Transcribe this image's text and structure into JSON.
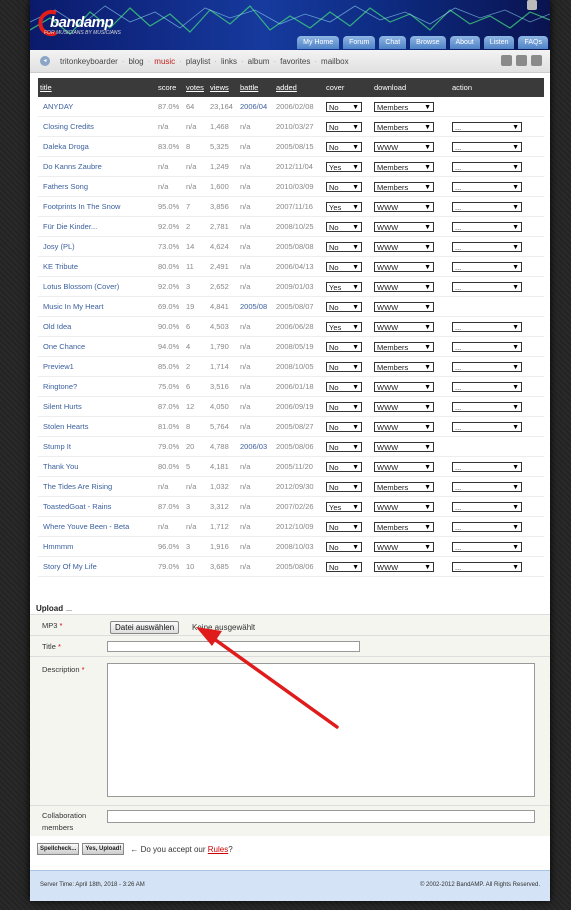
{
  "banner": {
    "logo_name": "bandamp",
    "logo_tagline": "FOR MUSICIANS BY MUSICIANS"
  },
  "nav": [
    "My Home",
    "Forum",
    "Chat",
    "Browse",
    "About",
    "Listen",
    "FAQs"
  ],
  "breadcrumb": [
    "tritonkeyboarder",
    "blog",
    "music",
    "playlist",
    "links",
    "album",
    "favorites",
    "mailbox"
  ],
  "breadcrumb_active": "music",
  "table": {
    "headers": [
      "title",
      "score",
      "votes",
      "views",
      "battle",
      "added",
      "cover",
      "download",
      "action"
    ],
    "rows": [
      {
        "title": "ANYDAY",
        "score": "87.0%",
        "votes": "64",
        "views": "23,164",
        "battle": "2006/04",
        "added": "2006/02/08",
        "cover": "No",
        "download": "Members",
        "action": ""
      },
      {
        "title": "Closing Credits",
        "score": "n/a",
        "votes": "n/a",
        "views": "1,468",
        "battle": "n/a",
        "added": "2010/03/27",
        "cover": "No",
        "download": "Members",
        "action": "..."
      },
      {
        "title": "Daleka Droga",
        "score": "83.0%",
        "votes": "8",
        "views": "5,325",
        "battle": "n/a",
        "added": "2005/08/15",
        "cover": "No",
        "download": "WWW",
        "action": "..."
      },
      {
        "title": "Do Kanns Zaubre",
        "score": "n/a",
        "votes": "n/a",
        "views": "1,249",
        "battle": "n/a",
        "added": "2012/11/04",
        "cover": "Yes",
        "download": "Members",
        "action": "..."
      },
      {
        "title": "Fathers Song",
        "score": "n/a",
        "votes": "n/a",
        "views": "1,600",
        "battle": "n/a",
        "added": "2010/03/09",
        "cover": "No",
        "download": "Members",
        "action": "..."
      },
      {
        "title": "Footprints In The Snow",
        "score": "95.0%",
        "votes": "7",
        "views": "3,856",
        "battle": "n/a",
        "added": "2007/11/16",
        "cover": "Yes",
        "download": "WWW",
        "action": "..."
      },
      {
        "title": "Für Die Kinder...",
        "score": "92.0%",
        "votes": "2",
        "views": "2,781",
        "battle": "n/a",
        "added": "2008/10/25",
        "cover": "No",
        "download": "WWW",
        "action": "..."
      },
      {
        "title": "Josy (PL)",
        "score": "73.0%",
        "votes": "14",
        "views": "4,624",
        "battle": "n/a",
        "added": "2005/08/08",
        "cover": "No",
        "download": "WWW",
        "action": "..."
      },
      {
        "title": "KE Tribute",
        "score": "80.0%",
        "votes": "11",
        "views": "2,491",
        "battle": "n/a",
        "added": "2006/04/13",
        "cover": "No",
        "download": "WWW",
        "action": "..."
      },
      {
        "title": "Lotus Blossom (Cover)",
        "score": "92.0%",
        "votes": "3",
        "views": "2,652",
        "battle": "n/a",
        "added": "2009/01/03",
        "cover": "Yes",
        "download": "WWW",
        "action": "..."
      },
      {
        "title": "Music In My Heart",
        "score": "69.0%",
        "votes": "19",
        "views": "4,841",
        "battle": "2005/08",
        "added": "2005/08/07",
        "cover": "No",
        "download": "WWW",
        "action": ""
      },
      {
        "title": "Old Idea",
        "score": "90.0%",
        "votes": "6",
        "views": "4,503",
        "battle": "n/a",
        "added": "2006/06/28",
        "cover": "Yes",
        "download": "WWW",
        "action": "..."
      },
      {
        "title": "One Chance",
        "score": "94.0%",
        "votes": "4",
        "views": "1,790",
        "battle": "n/a",
        "added": "2008/05/19",
        "cover": "No",
        "download": "Members",
        "action": "..."
      },
      {
        "title": "Preview1",
        "score": "85.0%",
        "votes": "2",
        "views": "1,714",
        "battle": "n/a",
        "added": "2008/10/05",
        "cover": "No",
        "download": "Members",
        "action": "..."
      },
      {
        "title": "Ringtone?",
        "score": "75.0%",
        "votes": "6",
        "views": "3,516",
        "battle": "n/a",
        "added": "2006/01/18",
        "cover": "No",
        "download": "WWW",
        "action": "..."
      },
      {
        "title": "Silent Hurts",
        "score": "87.0%",
        "votes": "12",
        "views": "4,050",
        "battle": "n/a",
        "added": "2006/09/19",
        "cover": "No",
        "download": "WWW",
        "action": "..."
      },
      {
        "title": "Stolen Hearts",
        "score": "81.0%",
        "votes": "8",
        "views": "5,764",
        "battle": "n/a",
        "added": "2005/08/27",
        "cover": "No",
        "download": "WWW",
        "action": "..."
      },
      {
        "title": "Stump It",
        "score": "79.0%",
        "votes": "20",
        "views": "4,788",
        "battle": "2006/03",
        "added": "2005/08/06",
        "cover": "No",
        "download": "WWW",
        "action": ""
      },
      {
        "title": "Thank You",
        "score": "80.0%",
        "votes": "5",
        "views": "4,181",
        "battle": "n/a",
        "added": "2005/11/20",
        "cover": "No",
        "download": "WWW",
        "action": "..."
      },
      {
        "title": "The Tides Are Rising",
        "score": "n/a",
        "votes": "n/a",
        "views": "1,032",
        "battle": "n/a",
        "added": "2012/09/30",
        "cover": "No",
        "download": "Members",
        "action": "..."
      },
      {
        "title": "ToastedGoat - Rains",
        "score": "87.0%",
        "votes": "3",
        "views": "3,312",
        "battle": "n/a",
        "added": "2007/02/26",
        "cover": "Yes",
        "download": "WWW",
        "action": "..."
      },
      {
        "title": "Where Youve Been - Beta",
        "score": "n/a",
        "votes": "n/a",
        "views": "1,712",
        "battle": "n/a",
        "added": "2012/10/09",
        "cover": "No",
        "download": "Members",
        "action": "..."
      },
      {
        "title": "Hmmmm",
        "score": "96.0%",
        "votes": "3",
        "views": "1,916",
        "battle": "n/a",
        "added": "2008/10/03",
        "cover": "No",
        "download": "WWW",
        "action": "..."
      },
      {
        "title": "Story Of My Life",
        "score": "79.0%",
        "votes": "10",
        "views": "3,685",
        "battle": "n/a",
        "added": "2005/08/06",
        "cover": "No",
        "download": "WWW",
        "action": "..."
      }
    ]
  },
  "upload": {
    "heading": "Upload",
    "mp3_label": "MP3",
    "file_button": "Datei auswählen",
    "file_status": "Keine ausgewählt",
    "title_label": "Title",
    "description_label": "Description",
    "collab_label": "Collaboration members",
    "required_marker": "*",
    "spellcheck_button": "Spellcheck...",
    "upload_button": "Yes, Upload!",
    "accept_prefix": "← Do you accept our",
    "rules_link": "Rules",
    "accept_suffix": "?"
  },
  "footer": {
    "server_time": "Server Time: April 18th, 2018 - 3:26 AM",
    "copyright": "© 2002-2012 BandAMP. All Rights Reserved."
  },
  "colors": {
    "banner": "#163a9e",
    "nav_tab": "#6f9bd6",
    "link": "#3a5f9e",
    "active": "#c02020",
    "arrow": "#e01b1b",
    "footer": "#d4e3f5"
  }
}
